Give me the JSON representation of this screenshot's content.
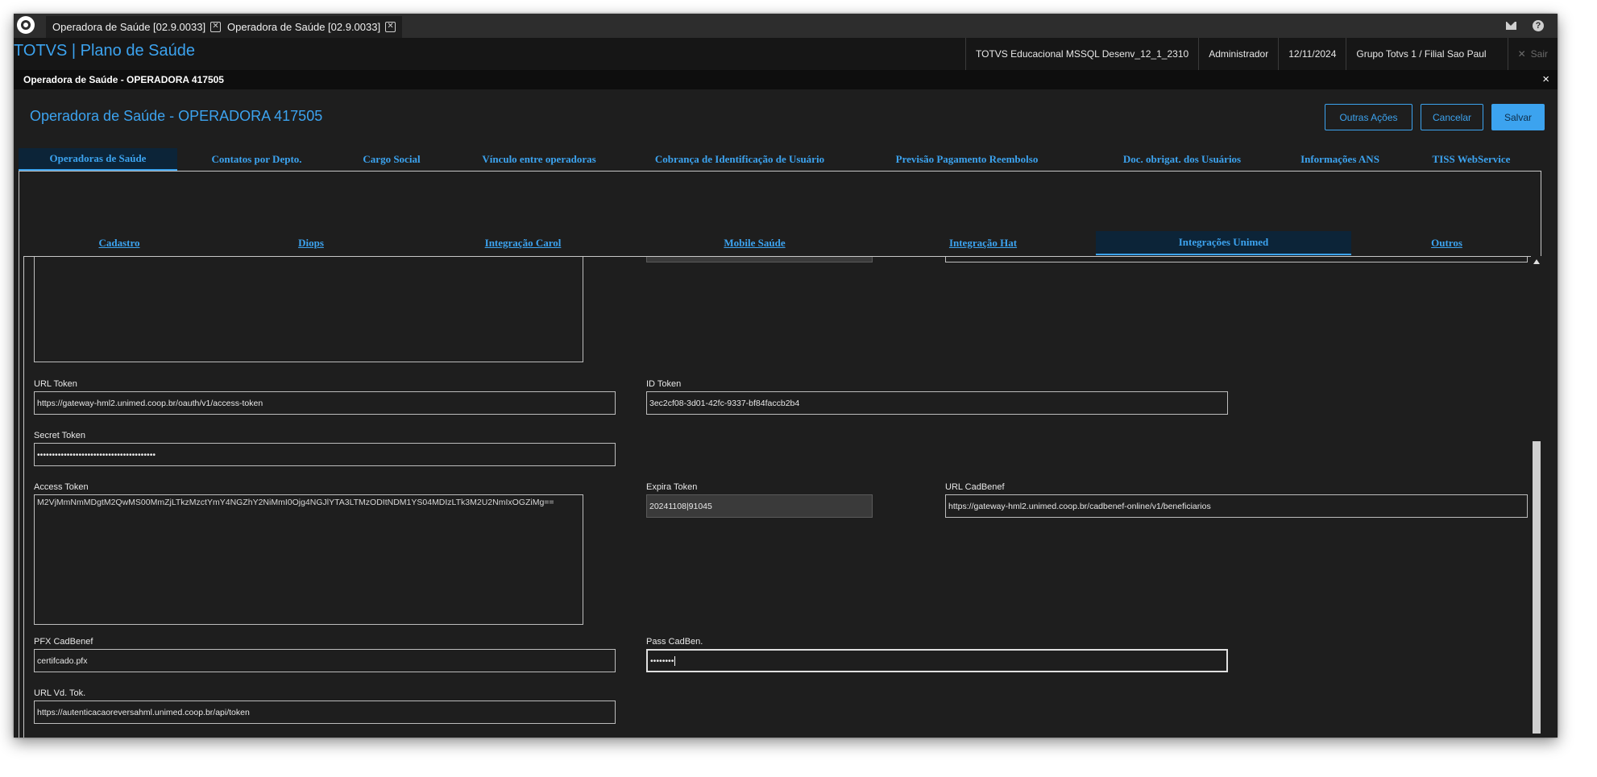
{
  "browser_tabs": [
    {
      "label": "Operadora de Saúde [02.9.0033]"
    },
    {
      "label": "Operadora de Saúde [02.9.0033]"
    }
  ],
  "header": {
    "brand": "TOTVS | Plano de Saúde",
    "environment": "TOTVS Educacional MSSQL Desenv_12_1_2310",
    "user": "Administrador",
    "date": "12/11/2024",
    "branch": "Grupo Totvs 1 / Filial Sao Paul",
    "exit_label": "Sair"
  },
  "dialog": {
    "title": "Operadora de Saúde - OPERADORA 417505",
    "close_glyph": "×"
  },
  "page": {
    "title": "Operadora de Saúde - OPERADORA 417505",
    "actions": {
      "more": "Outras Ações",
      "cancel": "Cancelar",
      "save": "Salvar"
    }
  },
  "main_tabs": [
    {
      "label": "Operadoras de Saúde",
      "active": true
    },
    {
      "label": "Contatos por Depto."
    },
    {
      "label": "Cargo Social"
    },
    {
      "label": "Vínculo entre operadoras"
    },
    {
      "label": "Cobrança de Identificação de Usuário"
    },
    {
      "label": "Previsão Pagamento Reembolso"
    },
    {
      "label": "Doc. obrigat. dos Usuários"
    },
    {
      "label": "Informações ANS"
    },
    {
      "label": "TISS WebService"
    }
  ],
  "sub_tabs": [
    {
      "label": "Cadastro"
    },
    {
      "label": "Diops"
    },
    {
      "label": "Integração Carol"
    },
    {
      "label": "Mobile Saúde"
    },
    {
      "label": "Integração Hat"
    },
    {
      "label": "Integrações Unimed",
      "active": true
    },
    {
      "label": "Outros"
    }
  ],
  "form": {
    "url_token": {
      "label": "URL Token",
      "value": "https://gateway-hml2.unimed.coop.br/oauth/v1/access-token"
    },
    "id_token": {
      "label": "ID Token",
      "value": "3ec2cf08-3d01-42fc-9337-bf84faccb2b4"
    },
    "secret_token": {
      "label": "Secret Token",
      "value": "••••••••••••••••••••••••••••••••••••••••"
    },
    "access_token": {
      "label": "Access Token",
      "value": "M2VjMmNmMDgtM2QwMS00MmZjLTkzMzctYmY4NGZhY2NiMmI0Ojg4NGJlYTA3LTMzODItNDM1YS04MDIzLTk3M2U2NmIxOGZiMg=="
    },
    "expira_token": {
      "label": "Expira Token",
      "value": "20241108|91045"
    },
    "url_cadbenef": {
      "label": "URL CadBenef",
      "value": "https://gateway-hml2.unimed.coop.br/cadbenef-online/v1/beneficiarios"
    },
    "pfx_cadbenef": {
      "label": "PFX CadBenef",
      "value": "certifcado.pfx"
    },
    "pass_cadben": {
      "label": "Pass CadBen.",
      "value": "••••••••"
    },
    "url_vd_tok": {
      "label": "URL Vd. Tok.",
      "value": "https://autenticacaoreversahml.unimed.coop.br/api/token"
    }
  },
  "icons": {
    "mail": "mail-icon",
    "help": "help-icon",
    "help_glyph": "?",
    "close_tab_glyph": "✕",
    "exit_glyph": "✕"
  },
  "colors": {
    "accent": "#3ca3ef",
    "background": "#1e1e1e",
    "header": "#161616"
  }
}
